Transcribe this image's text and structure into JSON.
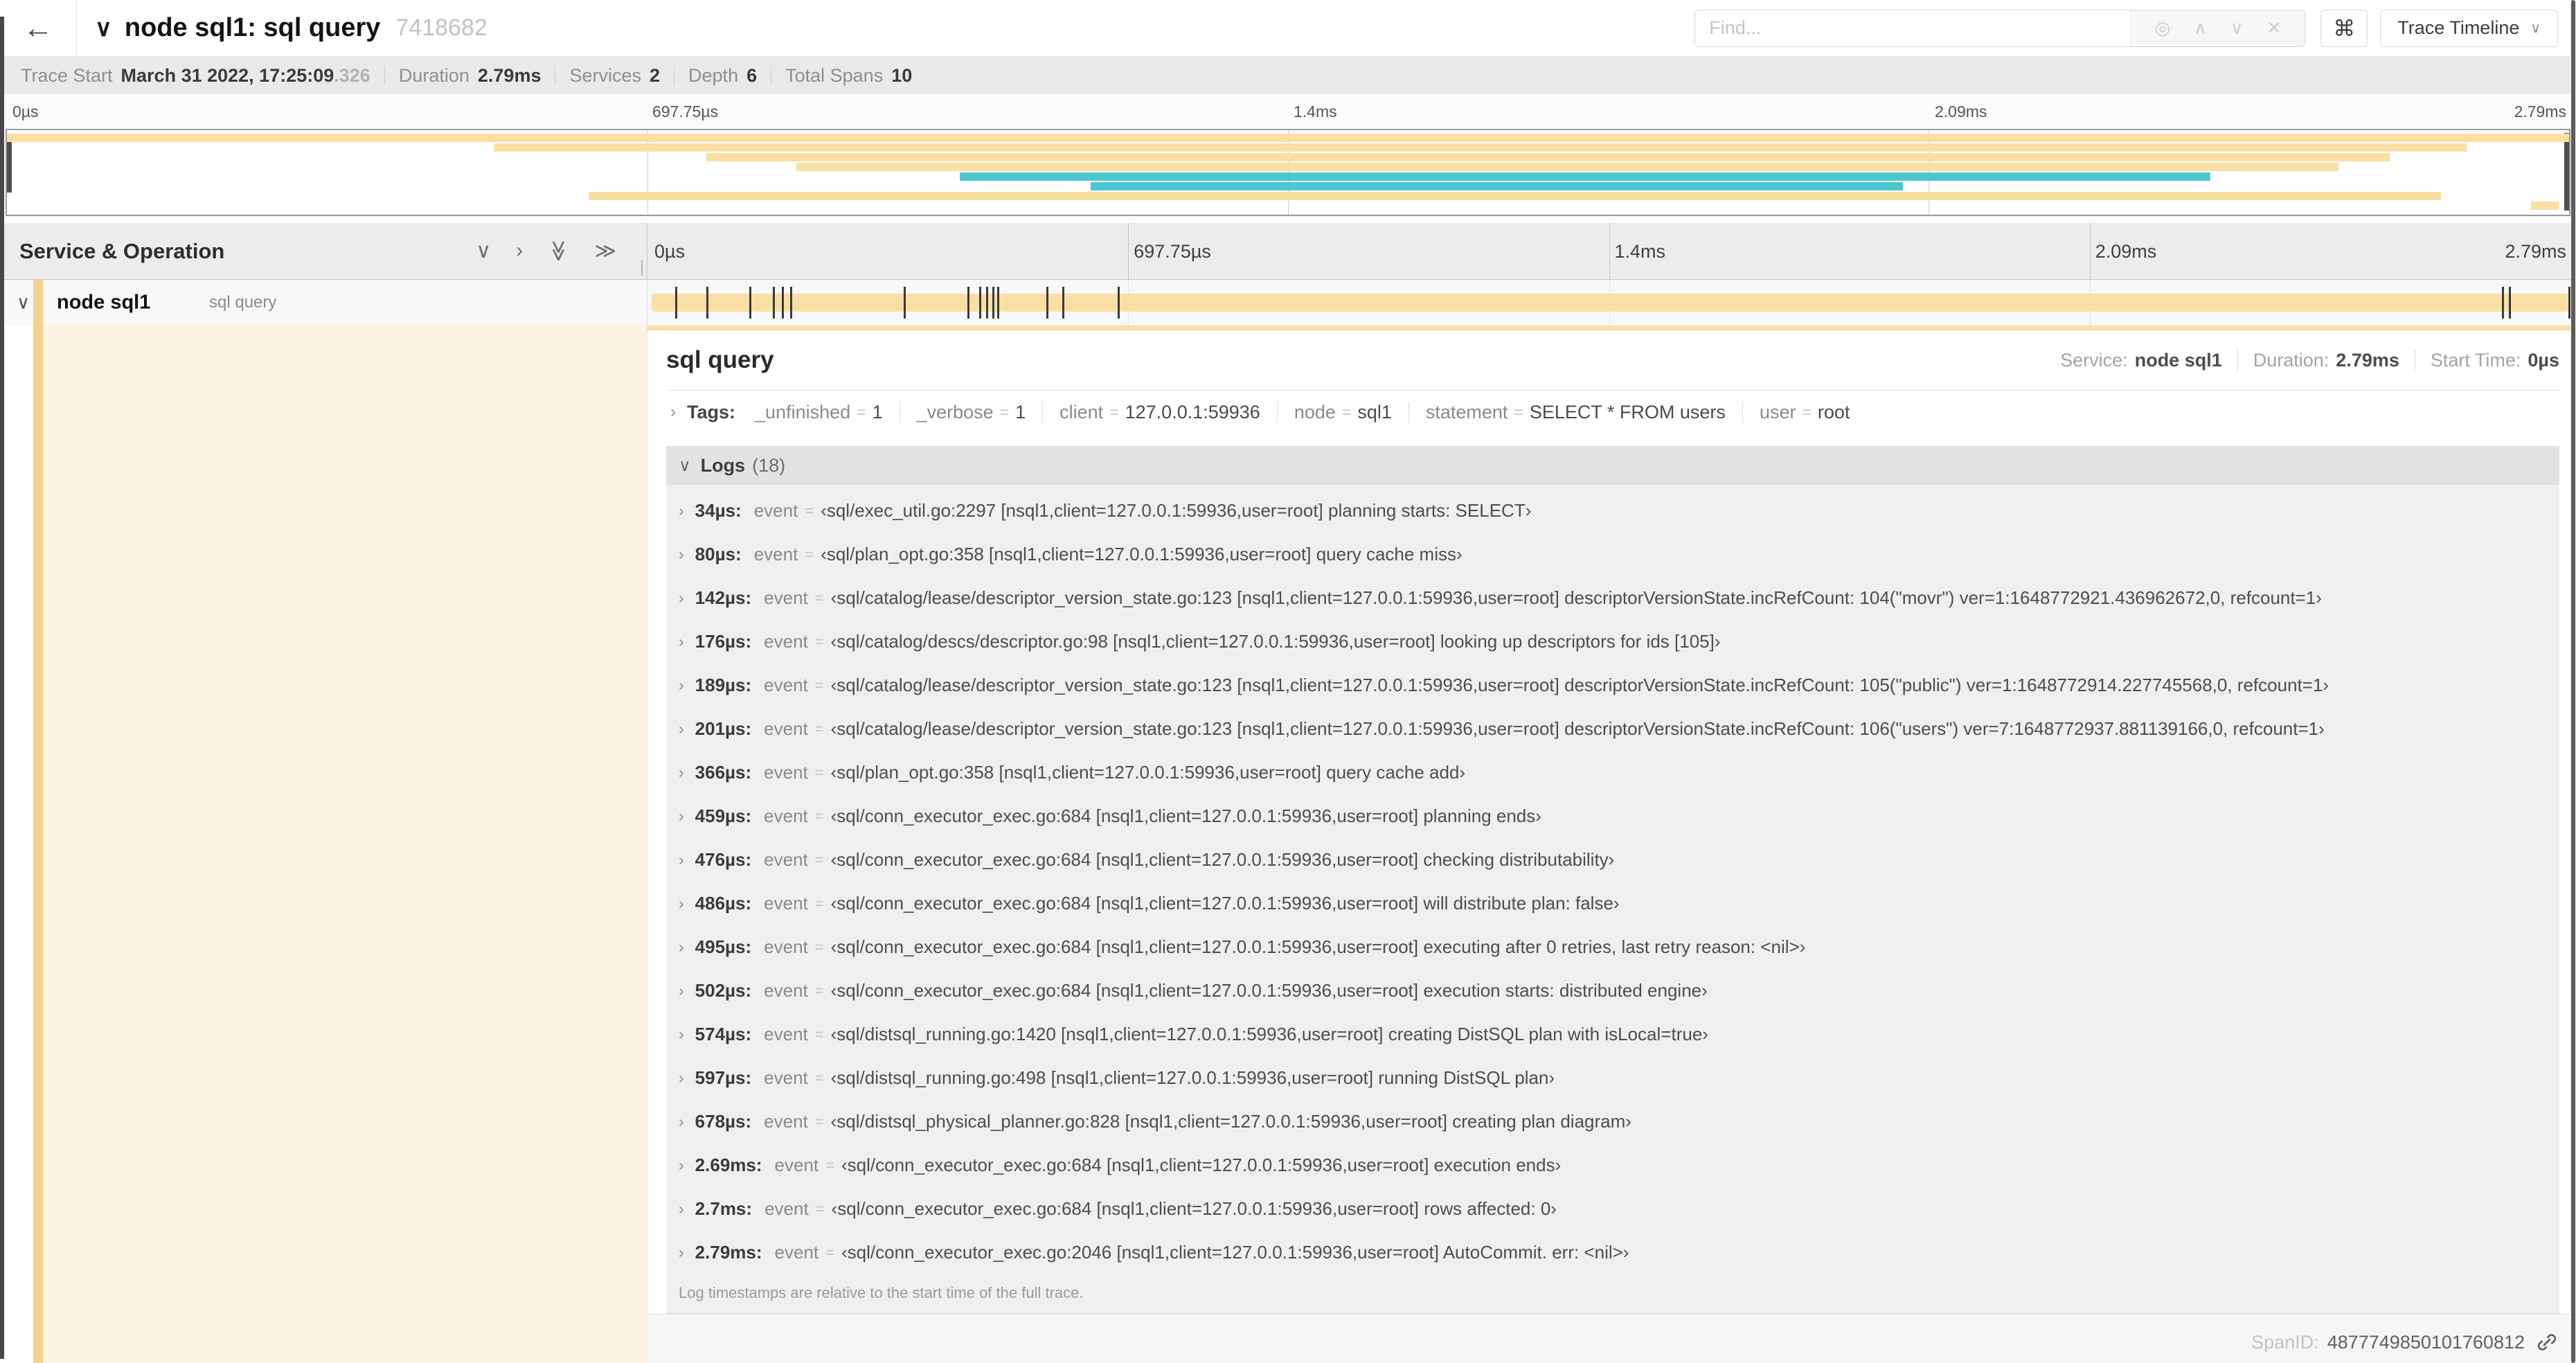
{
  "header": {
    "back_icon": "←",
    "collapse_icon": "∨",
    "title": "node sql1: sql query",
    "trace_id": "7418682",
    "find_placeholder": "Find...",
    "find_icons": {
      "locate": "◎",
      "prev": "∧",
      "next": "∨",
      "clear": "✕"
    },
    "shortcut_key": "⌘",
    "view_selector": "Trace Timeline",
    "view_selector_icon": "∨"
  },
  "trace_info": {
    "items": [
      {
        "label": "Trace Start",
        "value": "March 31 2022, 17:25:09",
        "suffix": ".326"
      },
      {
        "label": "Duration",
        "value": "2.79ms"
      },
      {
        "label": "Services",
        "value": "2"
      },
      {
        "label": "Depth",
        "value": "6"
      },
      {
        "label": "Total Spans",
        "value": "10"
      }
    ]
  },
  "timeline": {
    "ruler_ticks": [
      "0µs",
      "697.75µs",
      "1.4ms",
      "2.09ms",
      "2.79ms"
    ],
    "service_operation_label": "Service & Operation",
    "collapse_icons": [
      "∨",
      "›",
      "≫",
      "≫"
    ],
    "duration_us": 2790,
    "minimap_spans": [
      {
        "color": "tan",
        "start_pct": 0,
        "width_pct": 100
      },
      {
        "color": "tan",
        "start_pct": 19,
        "width_pct": 77
      },
      {
        "color": "tan",
        "start_pct": 27.3,
        "width_pct": 65.7
      },
      {
        "color": "tan",
        "start_pct": 30.8,
        "width_pct": 60.2
      },
      {
        "color": "teal",
        "start_pct": 37.2,
        "width_pct": 48.8
      },
      {
        "color": "teal",
        "start_pct": 42.3,
        "width_pct": 31.7
      },
      {
        "color": "tan",
        "start_pct": 22.7,
        "width_pct": 72.3
      },
      {
        "color": "tan",
        "start_pct": 98.5,
        "width_pct": 1.1
      }
    ],
    "span_row": {
      "service": "node sql1",
      "operation": "sql query",
      "expand_icon": "∨",
      "log_marker_us": [
        34,
        80,
        142,
        176,
        189,
        201,
        366,
        459,
        476,
        486,
        495,
        502,
        574,
        597,
        678,
        2690,
        2700,
        2790
      ]
    }
  },
  "detail": {
    "title": "sql query",
    "stats": [
      {
        "label": "Service:",
        "value": "node sql1"
      },
      {
        "label": "Duration:",
        "value": "2.79ms"
      },
      {
        "label": "Start Time:",
        "value": "0µs"
      }
    ],
    "tags_twisty_icon": "›",
    "tags_label": "Tags:",
    "tag_eq": "=",
    "tags": [
      {
        "key": "_unfinished",
        "value": "1"
      },
      {
        "key": "_verbose",
        "value": "1"
      },
      {
        "key": "client",
        "value": "127.0.0.1:59936"
      },
      {
        "key": "node",
        "value": "sql1"
      },
      {
        "key": "statement",
        "value": "SELECT * FROM users"
      },
      {
        "key": "user",
        "value": "root"
      }
    ],
    "logs_collapse_icon": "∨",
    "logs_label": "Logs",
    "logs_count": "(18)",
    "log_twisty_icon": "›",
    "log_eq": "=",
    "logs": [
      {
        "time": "34µs:",
        "field": "event",
        "value": "‹sql/exec_util.go:2297 [nsql1,client=127.0.0.1:59936,user=root] planning starts: SELECT›"
      },
      {
        "time": "80µs:",
        "field": "event",
        "value": "‹sql/plan_opt.go:358 [nsql1,client=127.0.0.1:59936,user=root] query cache miss›"
      },
      {
        "time": "142µs:",
        "field": "event",
        "value": "‹sql/catalog/lease/descriptor_version_state.go:123 [nsql1,client=127.0.0.1:59936,user=root] descriptorVersionState.incRefCount: 104(\"movr\") ver=1:1648772921.436962672,0, refcount=1›"
      },
      {
        "time": "176µs:",
        "field": "event",
        "value": "‹sql/catalog/descs/descriptor.go:98 [nsql1,client=127.0.0.1:59936,user=root] looking up descriptors for ids [105]›"
      },
      {
        "time": "189µs:",
        "field": "event",
        "value": "‹sql/catalog/lease/descriptor_version_state.go:123 [nsql1,client=127.0.0.1:59936,user=root] descriptorVersionState.incRefCount: 105(\"public\") ver=1:1648772914.227745568,0, refcount=1›"
      },
      {
        "time": "201µs:",
        "field": "event",
        "value": "‹sql/catalog/lease/descriptor_version_state.go:123 [nsql1,client=127.0.0.1:59936,user=root] descriptorVersionState.incRefCount: 106(\"users\") ver=7:1648772937.881139166,0, refcount=1›"
      },
      {
        "time": "366µs:",
        "field": "event",
        "value": "‹sql/plan_opt.go:358 [nsql1,client=127.0.0.1:59936,user=root] query cache add›"
      },
      {
        "time": "459µs:",
        "field": "event",
        "value": "‹sql/conn_executor_exec.go:684 [nsql1,client=127.0.0.1:59936,user=root] planning ends›"
      },
      {
        "time": "476µs:",
        "field": "event",
        "value": "‹sql/conn_executor_exec.go:684 [nsql1,client=127.0.0.1:59936,user=root] checking distributability›"
      },
      {
        "time": "486µs:",
        "field": "event",
        "value": "‹sql/conn_executor_exec.go:684 [nsql1,client=127.0.0.1:59936,user=root] will distribute plan: false›"
      },
      {
        "time": "495µs:",
        "field": "event",
        "value": "‹sql/conn_executor_exec.go:684 [nsql1,client=127.0.0.1:59936,user=root] executing after 0 retries, last retry reason: <nil>›"
      },
      {
        "time": "502µs:",
        "field": "event",
        "value": "‹sql/conn_executor_exec.go:684 [nsql1,client=127.0.0.1:59936,user=root] execution starts: distributed engine›"
      },
      {
        "time": "574µs:",
        "field": "event",
        "value": "‹sql/distsql_running.go:1420 [nsql1,client=127.0.0.1:59936,user=root] creating DistSQL plan with isLocal=true›"
      },
      {
        "time": "597µs:",
        "field": "event",
        "value": "‹sql/distsql_running.go:498 [nsql1,client=127.0.0.1:59936,user=root] running DistSQL plan›"
      },
      {
        "time": "678µs:",
        "field": "event",
        "value": "‹sql/distsql_physical_planner.go:828 [nsql1,client=127.0.0.1:59936,user=root] creating plan diagram›"
      },
      {
        "time": "2.69ms:",
        "field": "event",
        "value": "‹sql/conn_executor_exec.go:684 [nsql1,client=127.0.0.1:59936,user=root] execution ends›"
      },
      {
        "time": "2.7ms:",
        "field": "event",
        "value": "‹sql/conn_executor_exec.go:684 [nsql1,client=127.0.0.1:59936,user=root] rows affected: 0›"
      },
      {
        "time": "2.79ms:",
        "field": "event",
        "value": "‹sql/conn_executor_exec.go:2046 [nsql1,client=127.0.0.1:59936,user=root] AutoCommit. err: <nil>›"
      }
    ],
    "logs_footnote": "Log timestamps are relative to the start time of the full trace.",
    "span_id_label": "SpanID:",
    "span_id": "4877749850101760812"
  },
  "colors": {
    "span_tan": "#F9DFA4",
    "span_teal": "#4BC8CF",
    "accent_stripe": "#F6D18F",
    "detail_row_bg": "#FCF3E2"
  }
}
